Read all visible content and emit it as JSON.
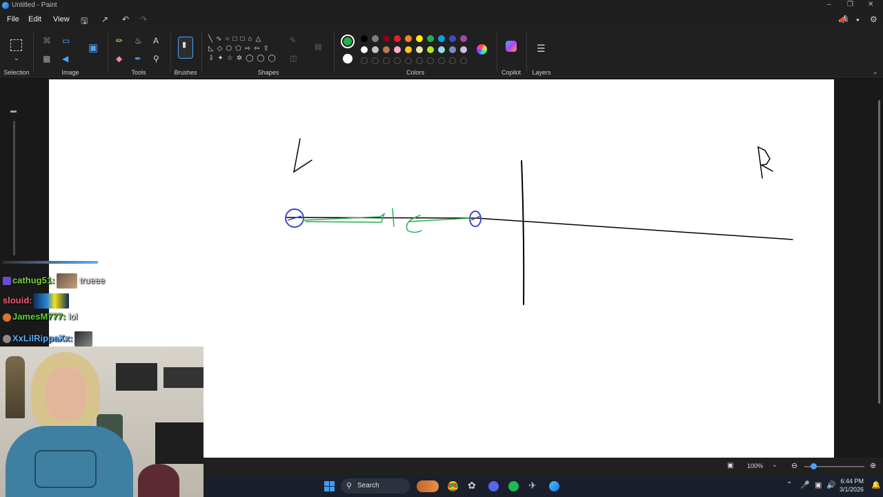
{
  "window": {
    "title": "Untitled - Paint"
  },
  "menu": {
    "file": "File",
    "edit": "Edit",
    "view": "View"
  },
  "ribbon": {
    "groups": {
      "selection": "Selection",
      "image": "Image",
      "tools": "Tools",
      "brushes": "Brushes",
      "shapes": "Shapes",
      "colors": "Colors",
      "copilot": "Copilot",
      "layers": "Layers"
    },
    "palette_row1": [
      "#000000",
      "#7f7f7f",
      "#880015",
      "#ed1c24",
      "#ff7f27",
      "#fff200",
      "#22b14c",
      "#00a2e8",
      "#3f48cc",
      "#a349a4"
    ],
    "palette_row2": [
      "#ffffff",
      "#c3c3c3",
      "#b97a57",
      "#ffaec9",
      "#ffc90e",
      "#efe4b0",
      "#b5e61d",
      "#99d9ea",
      "#7092be",
      "#c8bfe7"
    ],
    "primary_color": "#22b14c",
    "secondary_color": "#ffffff"
  },
  "status": {
    "zoom": "100%"
  },
  "taskbar": {
    "search_placeholder": "Search",
    "time": "6:44 PM",
    "date": "3/1/2026"
  },
  "chat": [
    {
      "user": "cathug51:",
      "message": "trueee",
      "color": "#7dd13b"
    },
    {
      "user": "slouid:",
      "message": "",
      "color": "#ff5a7a"
    },
    {
      "user": "JamesM777:",
      "message": "lol",
      "color": "#5fd33a"
    },
    {
      "user": "XxLilRippaXx:",
      "message": "",
      "color": "#5ab0ff"
    }
  ]
}
